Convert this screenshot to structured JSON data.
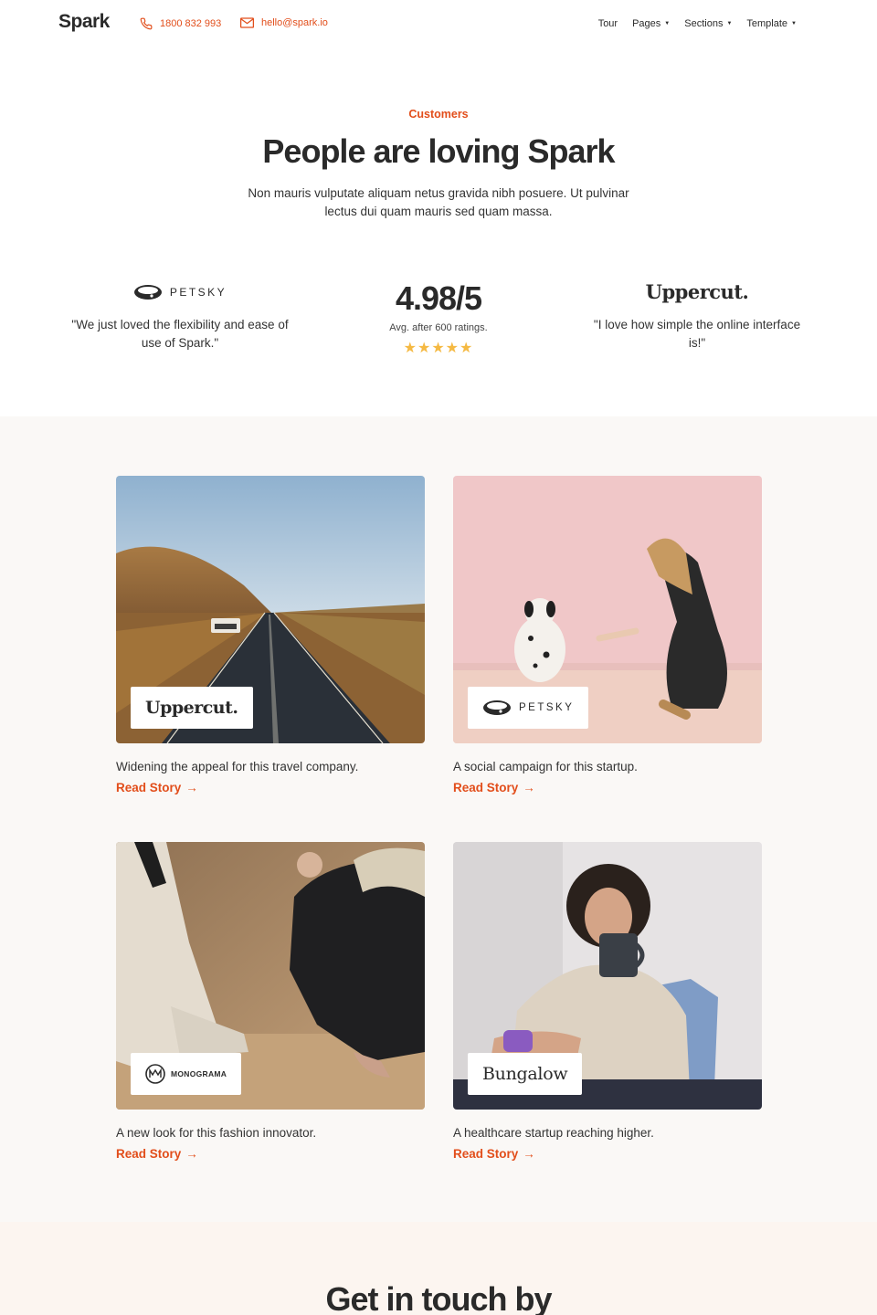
{
  "header": {
    "logo": "Spark",
    "phone": "1800 832 993",
    "email": "hello@spark.io",
    "nav": [
      {
        "label": "Tour",
        "dropdown": false
      },
      {
        "label": "Pages",
        "dropdown": true
      },
      {
        "label": "Sections",
        "dropdown": true
      },
      {
        "label": "Template",
        "dropdown": true
      }
    ]
  },
  "intro": {
    "eyebrow": "Customers",
    "headline": "People are loving Spark",
    "lede": "Non mauris vulputate aliquam netus gravida nibh posuere. Ut pulvinar lectus dui quam mauris sed quam massa."
  },
  "testimonials": {
    "left": {
      "brand": "PETSKY",
      "quote": "\"We just loved the flexibility and ease of use of Spark.\""
    },
    "rating": {
      "value": "4.98/5",
      "caption": "Avg. after 600 ratings.",
      "stars": 5
    },
    "right": {
      "brand": "Uppercut.",
      "quote": "\"I love how simple the online interface is!\""
    }
  },
  "stories": [
    {
      "brand": "Uppercut.",
      "description": "Widening the appeal for this travel company.",
      "link": "Read Story"
    },
    {
      "brand": "PETSKY",
      "description": "A social campaign for this startup.",
      "link": "Read Story"
    },
    {
      "brand": "MONOGRAMA",
      "description": "A new look for this fashion innovator.",
      "link": "Read Story"
    },
    {
      "brand": "Bungalow",
      "description": "A healthcare startup reaching higher.",
      "link": "Read Story"
    }
  ],
  "contact": {
    "title": "Get in touch by"
  },
  "colors": {
    "accent": "#e24e1b",
    "star": "#f5b942",
    "section_bg": "#faf8f6",
    "contact_bg": "#fcf5f0"
  },
  "icons": [
    "phone-icon",
    "mail-icon",
    "caret-down-icon",
    "star-icon",
    "arrow-right-icon",
    "collar-logo-icon",
    "monogram-logo-icon"
  ]
}
